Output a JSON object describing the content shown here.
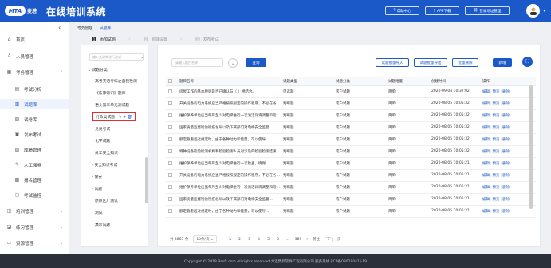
{
  "header": {
    "logo_text": "MTA",
    "logo_sub": "麦塔",
    "title": "在线培训系统",
    "buttons": [
      {
        "label": "帮助中心",
        "icon": "help-icon"
      },
      {
        "label": "APP下载",
        "icon": "phone-icon"
      },
      {
        "label": "登录地址管理",
        "icon": "link-icon"
      }
    ]
  },
  "sidebar": {
    "items": [
      {
        "label": "首页",
        "icon": "home-icon",
        "arrow": ""
      },
      {
        "label": "人员管理",
        "icon": "user-icon",
        "arrow": "⌄"
      },
      {
        "label": "考务管理",
        "icon": "calendar-icon",
        "arrow": "⌃"
      },
      {
        "label": "考试分析",
        "icon": "chart-icon",
        "arrow": ""
      },
      {
        "label": "试题库",
        "icon": "book-icon",
        "arrow": ""
      },
      {
        "label": "试卷库",
        "icon": "paper-icon",
        "arrow": ""
      },
      {
        "label": "发布考试",
        "icon": "publish-icon",
        "arrow": ""
      },
      {
        "label": "成绩管理",
        "icon": "score-icon",
        "arrow": ""
      },
      {
        "label": "人工阅卷",
        "icon": "pen-icon",
        "arrow": ""
      },
      {
        "label": "报名管理",
        "icon": "signup-icon",
        "arrow": ""
      },
      {
        "label": "考试监控",
        "icon": "monitor-icon",
        "arrow": ""
      },
      {
        "label": "培训管理",
        "icon": "training-icon",
        "arrow": "⌄"
      },
      {
        "label": "练习管理",
        "icon": "practice-icon",
        "arrow": "⌄"
      },
      {
        "label": "资源管理",
        "icon": "folder-icon",
        "arrow": "⌄"
      }
    ]
  },
  "breadcrumb": {
    "parent": "考务管理",
    "sep": "/",
    "current": "试题库"
  },
  "steps": [
    {
      "num": "1",
      "label": "添加试题"
    },
    {
      "num": "2",
      "label": "题目设置"
    },
    {
      "num": "3",
      "label": "发布考试"
    }
  ],
  "tree": {
    "search_placeholder": "输入关键字进行过滤",
    "root": "试题分类",
    "nodes": [
      "高考英语专练之自我检测",
      "《法律常识》题库",
      "语文第三单元测试题",
      "行政类试题",
      "党员考试",
      "化学试题",
      "员工安全知识",
      "安全知识考试",
      "保安",
      "试题",
      "原州区广测试",
      "测试",
      "演示试题"
    ],
    "node_actions": "✎ + 🗑"
  },
  "toolbar": {
    "search_placeholder": "请输入题目名称",
    "search_btn": "查询",
    "import_btn": "试题批量导入",
    "export_btn": "试题批量导出",
    "batch_delete_btn": "批量删除",
    "add_btn": "新增"
  },
  "table": {
    "headers": [
      "题目名称",
      "试题类型",
      "试题分类",
      "试题难度",
      "创建时间",
      "操作"
    ],
    "rows": [
      [
        "房屋工作的基本原则是否已确认与（ ）相结合。",
        "单选题",
        "客户试题",
        "简单",
        "2020-09-04 10:32:02"
      ],
      [
        "开关设备的电力系统应当严格按照规定的操作程序，不必在各操...",
        "判断题",
        "客户试题",
        "简单",
        "2020-08-05 10:05:32"
      ],
      [
        "维护保养单位应当每月至少对电梯进行一次清洁润滑调整和检查...",
        "判断题",
        "客户试题",
        "简单",
        "2020-08-05 10:05:32"
      ],
      [
        "国家质量监督检验检疫总局以及下属部门对电梯安全监督...",
        "判断题",
        "客户试题",
        "简单",
        "2020-08-05 10:05:32"
      ],
      [
        "额定载重超过规定时，由于各种动力和能量，可以使导...",
        "判断题",
        "客户试题",
        "简单",
        "2020-08-05 10:05:32"
      ],
      [
        "特种设备检验检测机构和检验检测人员对涉及的检验检测结果...",
        "判断题",
        "客户试题",
        "简单",
        "2020-08-05 10:05:32"
      ],
      [
        "维护保养单位应当每月至少对电梯进行一次检查，确保...",
        "判断题",
        "客户试题",
        "简单",
        "2020-08-05 10:05:21"
      ],
      [
        "开关设备的电力系统应当严格按照规定的操作程序，不必在各操...",
        "判断题",
        "客户试题",
        "简单",
        "2020-08-05 10:05:21"
      ],
      [
        "维护保养单位应当每月至少对电梯进行一次清洁润滑调整和检查...",
        "判断题",
        "客户试题",
        "简单",
        "2020-08-05 10:05:21"
      ],
      [
        "国家质量监督检验检疫总局以及下属部门对电梯安全监督...",
        "判断题",
        "客户试题",
        "简单",
        "2020-08-05 10:05:21"
      ],
      [
        "额定载重超过规定时，由于各种动力和能量，可以使导...",
        "判断题",
        "客户试题",
        "简单",
        "2020-08-05 10:05:21"
      ]
    ],
    "ops": [
      "编辑",
      "预览",
      "删除"
    ]
  },
  "pager": {
    "total": "共 3865 条",
    "page_size": "10条/页",
    "pages": [
      "1",
      "2",
      "3",
      "4",
      "5",
      "6",
      "...",
      "389"
    ],
    "prev": "‹",
    "next": "›",
    "goto_label": "前往",
    "goto_value": "1",
    "goto_suffix": "页"
  },
  "footer": {
    "text": "Copyright © 2019 Bsoft.com All rights reserved 大连集邦软件工程有限公司 服务热线 [ICP备09029041]-19"
  }
}
